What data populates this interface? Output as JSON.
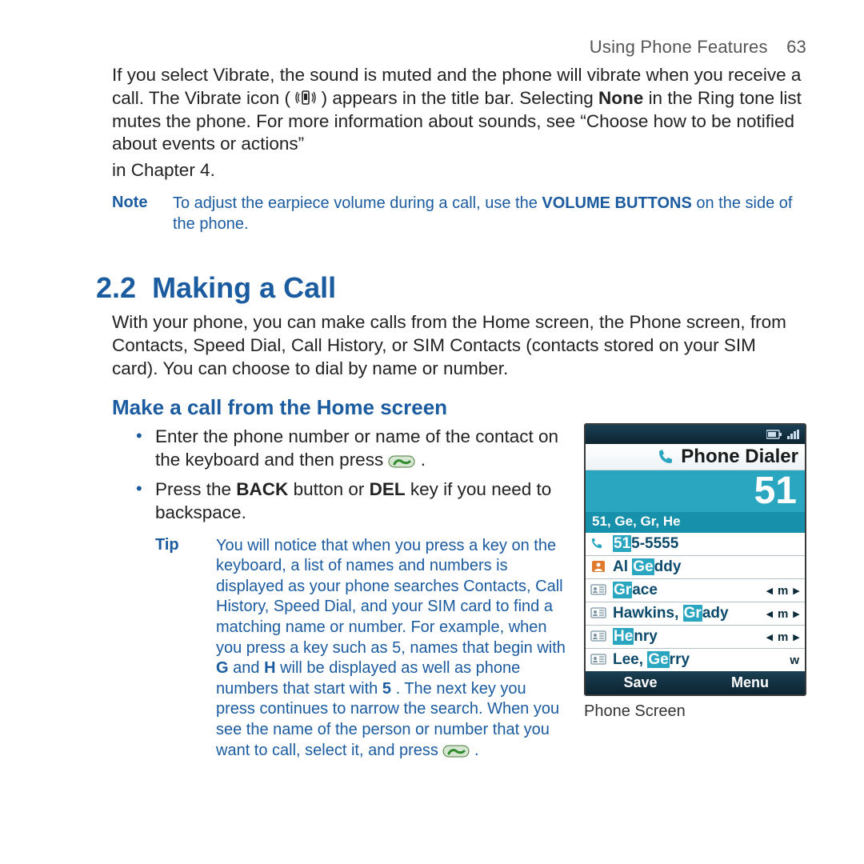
{
  "header": {
    "section": "Using Phone Features",
    "page": "63"
  },
  "intro": {
    "p1a": "If you select Vibrate, the sound is muted and the phone will vibrate when you receive a call. The Vibrate icon (",
    "p1b": ") appears in the title bar. Selecting ",
    "p1_bold": "None",
    "p1c": " in the Ring tone list mutes the phone. For more information about sounds, see “Choose how to be notified about events or actions”",
    "p2": "in Chapter 4."
  },
  "note": {
    "label": "Note",
    "text_a": "To adjust the earpiece volume during a call, use the ",
    "text_bold": "VOLUME BUTTONS",
    "text_b": " on the side of the phone."
  },
  "section": {
    "num": "2.2",
    "title": "Making a Call"
  },
  "para_intro": "With your phone, you can make calls from the Home screen, the Phone screen, from Contacts, Speed Dial, Call History, or SIM Contacts (contacts stored on your SIM card). You can choose to dial by name or number.",
  "sub1": {
    "title": "Make a call from the Home screen"
  },
  "bullets": {
    "b1a": "Enter the phone number or name of the contact on the keyboard and then press ",
    "b1b": ".",
    "b2a": "Press the ",
    "b2_bold1": "BACK",
    "b2b": " button or ",
    "b2_bold2": "DEL",
    "b2c": " key if you need to backspace."
  },
  "tip": {
    "label": "Tip",
    "t1": "You will notice that when you press a key on the keyboard, a list of names and numbers is displayed as your phone searches Contacts, Call History, Speed Dial, and your SIM card to find a matching name or number. For example, when you press a key such as 5, names that begin with ",
    "b1": "G",
    "t2": " and ",
    "b2": "H",
    "t3": " will be displayed as well as phone numbers that start with ",
    "b3": "5",
    "t4": ". The next key you press continues to narrow the search. When you see the name of the person or number that you want to call, select it, and press ",
    "t5": "."
  },
  "phone": {
    "title": "Phone Dialer",
    "entered": "51",
    "hint": "51, Ge, Gr, He",
    "rows": [
      {
        "icon": "call",
        "pre": "51",
        "rest": "5-5555",
        "side": ""
      },
      {
        "icon": "contact",
        "pre": "",
        "rest_a": "Al ",
        "hl": "Ge",
        "rest_b": "ddy",
        "side": ""
      },
      {
        "icon": "card",
        "pre": "Gr",
        "rest": "ace",
        "side": "◂ m ▸"
      },
      {
        "icon": "card",
        "pre": "",
        "rest_a": "Hawkins, ",
        "hl": "Gr",
        "rest_b": "ady",
        "side": "◂ m ▸"
      },
      {
        "icon": "card",
        "pre": "He",
        "rest": "nry",
        "side": "◂ m ▸"
      },
      {
        "icon": "card",
        "pre": "",
        "rest_a": "Lee, ",
        "hl": "Ge",
        "rest_b": "rry",
        "side": "w"
      }
    ],
    "soft_left": "Save",
    "soft_right": "Menu",
    "caption": "Phone Screen"
  }
}
